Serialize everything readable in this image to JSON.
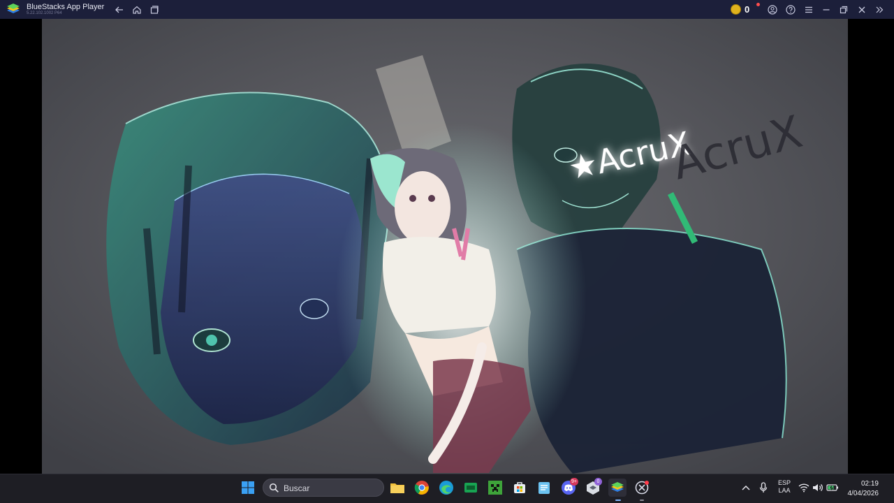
{
  "window": {
    "title": "BlueStacks App Player",
    "version": "5.22.102.1002 P64",
    "coin_count": "0",
    "icons": [
      "back-icon",
      "home-icon",
      "multi-instance-icon",
      "coin-icon",
      "account-icon",
      "help-icon",
      "menu-icon",
      "minimize-icon",
      "restore-icon",
      "close-icon",
      "collapse-sidebar-icon"
    ]
  },
  "game": {
    "signature": "★AcruX",
    "signature_echo": "AcruX"
  },
  "taskbar": {
    "search_placeholder": "Buscar",
    "apps": [
      "windows-start",
      "file-explorer",
      "chrome",
      "edge",
      "xbox-app",
      "minecraft",
      "microsoft-store",
      "notepad",
      "discord",
      "virtualbox",
      "bluestacks",
      "bluestacks-x"
    ],
    "discord_badge": "9+",
    "virtualbox_badge": "0",
    "language_line1": "ESP",
    "language_line2": "LAA",
    "time": "02:19",
    "date": "4/04/2026"
  },
  "colors": {
    "titlebar": "#1c1f3a",
    "taskbar": "#1e1e24",
    "accent_teal": "#4fd1b5",
    "coin": "#e0b21d"
  }
}
